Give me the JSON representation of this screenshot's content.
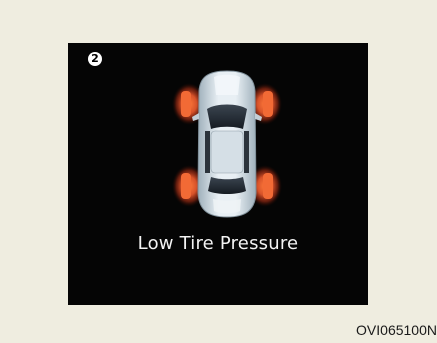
{
  "display": {
    "badge_number": "2",
    "message": "Low Tire Pressure",
    "warning_color": "#e2562b",
    "car_color": "#dfe8ee",
    "tires": [
      {
        "position": "front-left",
        "status": "low"
      },
      {
        "position": "front-right",
        "status": "low"
      },
      {
        "position": "rear-left",
        "status": "low"
      },
      {
        "position": "rear-right",
        "status": "low"
      }
    ]
  },
  "caption": {
    "code": "OVI065100N"
  }
}
